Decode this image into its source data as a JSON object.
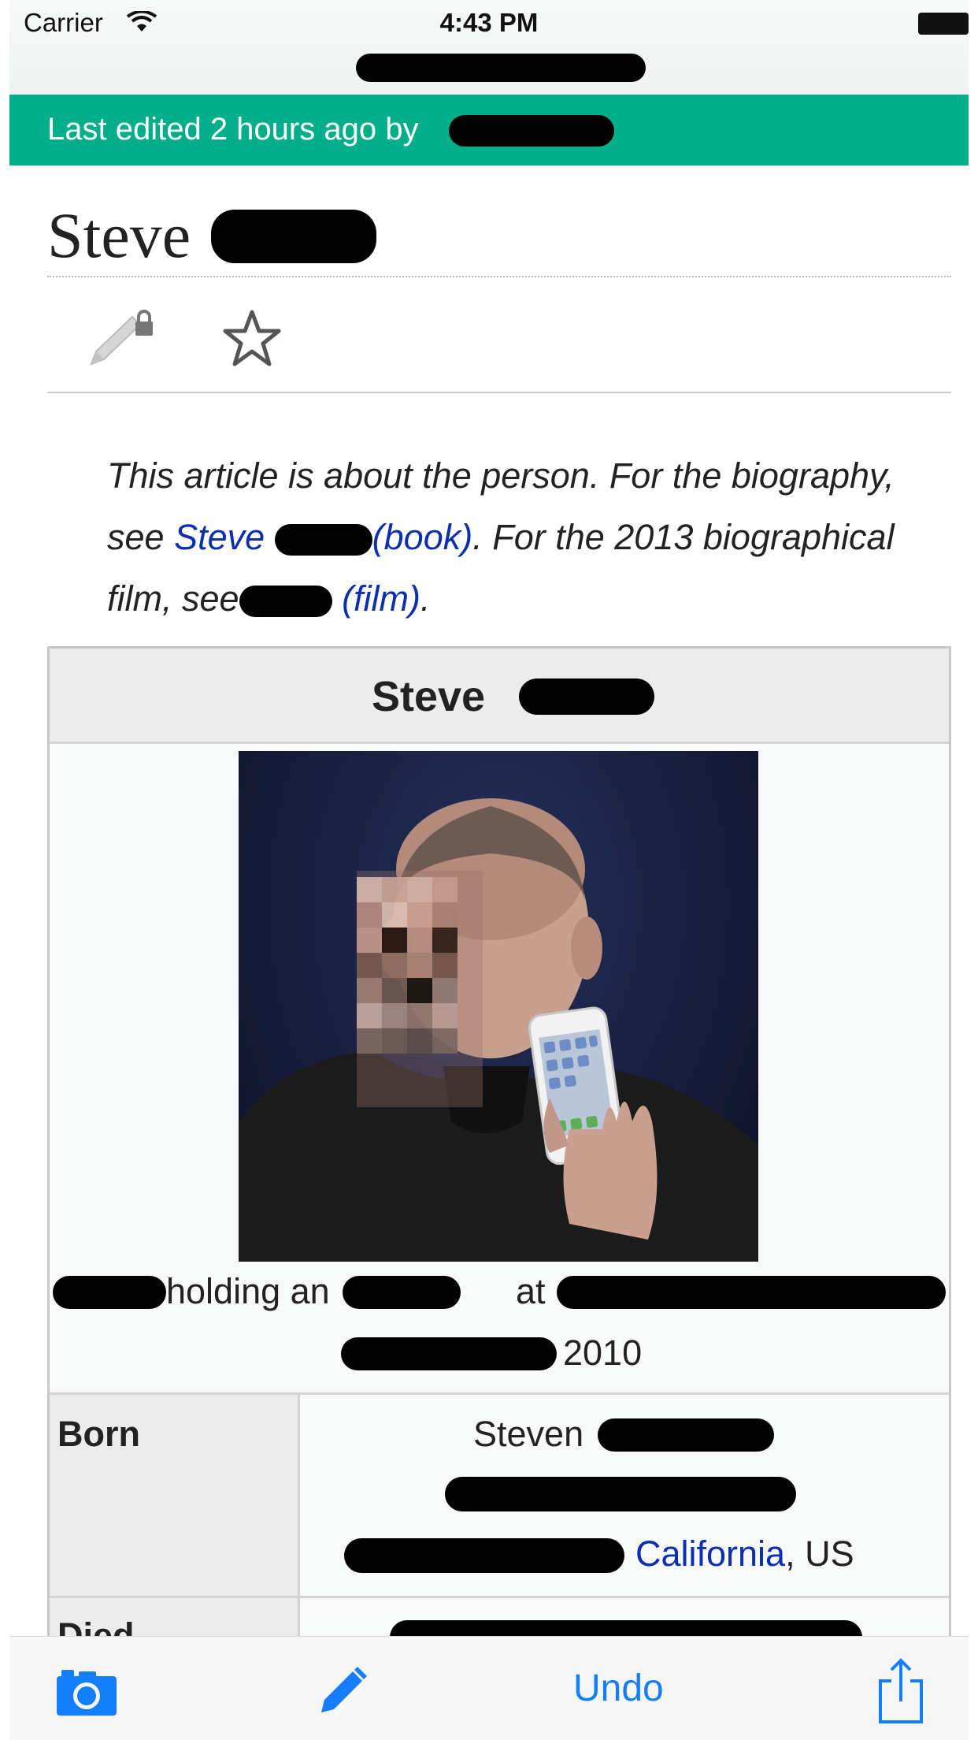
{
  "status_bar": {
    "carrier": "Carrier",
    "time": "4:43 PM"
  },
  "banner": {
    "text": "Last edited 2 hours ago by"
  },
  "article": {
    "title": "Steve"
  },
  "hatnote": {
    "part1": "This article is about the person. For the biography, see ",
    "link_book_a": "Steve",
    "link_book_b": "(book)",
    "part2": ". For the 2013 biographical film, see",
    "link_film": "(film)",
    "part3": "."
  },
  "infobox": {
    "header": "Steve",
    "caption_a": "holding an",
    "caption_b": "at",
    "caption_year": "2010",
    "born_label": "Born",
    "born_value_line1": "Steven",
    "born_place_link": "California",
    "born_place_suffix": ", US",
    "died_label": "Died"
  },
  "toolbar": {
    "undo_label": "Undo"
  },
  "colors": {
    "banner": "#00af89",
    "link": "#0b2fb0",
    "ios_blue": "#157efb"
  },
  "icons": [
    "wifi-icon",
    "battery-icon",
    "edit-locked-icon",
    "star-icon",
    "camera-icon",
    "pencil-icon",
    "share-icon"
  ]
}
